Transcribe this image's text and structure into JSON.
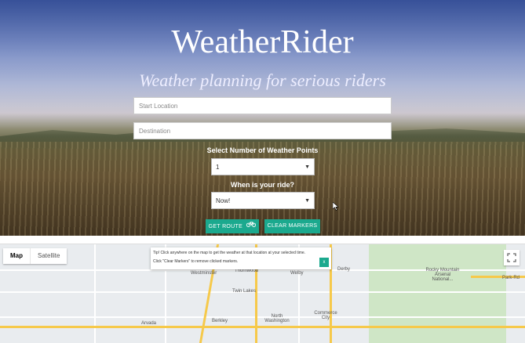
{
  "app": {
    "title": "WeatherRider",
    "subtitle": "Weather planning for serious riders"
  },
  "form": {
    "start_placeholder": "Start Location",
    "destination_placeholder": "Destination",
    "points_label": "Select Number of Weather Points",
    "points_value": "1",
    "when_label": "When is your ride?",
    "when_value": "Now!",
    "get_route_label": "GET ROUTE",
    "clear_markers_label": "CLEAR MARKERS",
    "caret_icon": "chevron-down-icon",
    "bike_icon": "bicycle-icon"
  },
  "map": {
    "tabs": [
      {
        "label": "Map",
        "active": true
      },
      {
        "label": "Satellite",
        "active": false
      }
    ],
    "tip": {
      "line1": "Tip! Click anywhere on the map to get the weather at that location at your selected time.",
      "line2": "Click \"Clear Markers\" to remove clicked markers.",
      "close_label": "x"
    },
    "labels": [
      "Westminster",
      "Thornwood",
      "Welby",
      "Derby",
      "Twin Lakes",
      "Rocky Mountain Arsenal National...",
      "Arvada",
      "Berkley",
      "North Washington",
      "Commerce City",
      "Park-Rd"
    ],
    "colors": {
      "park": "#cfe6c6",
      "highway": "#f6c94a",
      "accent": "#1ba98e"
    }
  }
}
